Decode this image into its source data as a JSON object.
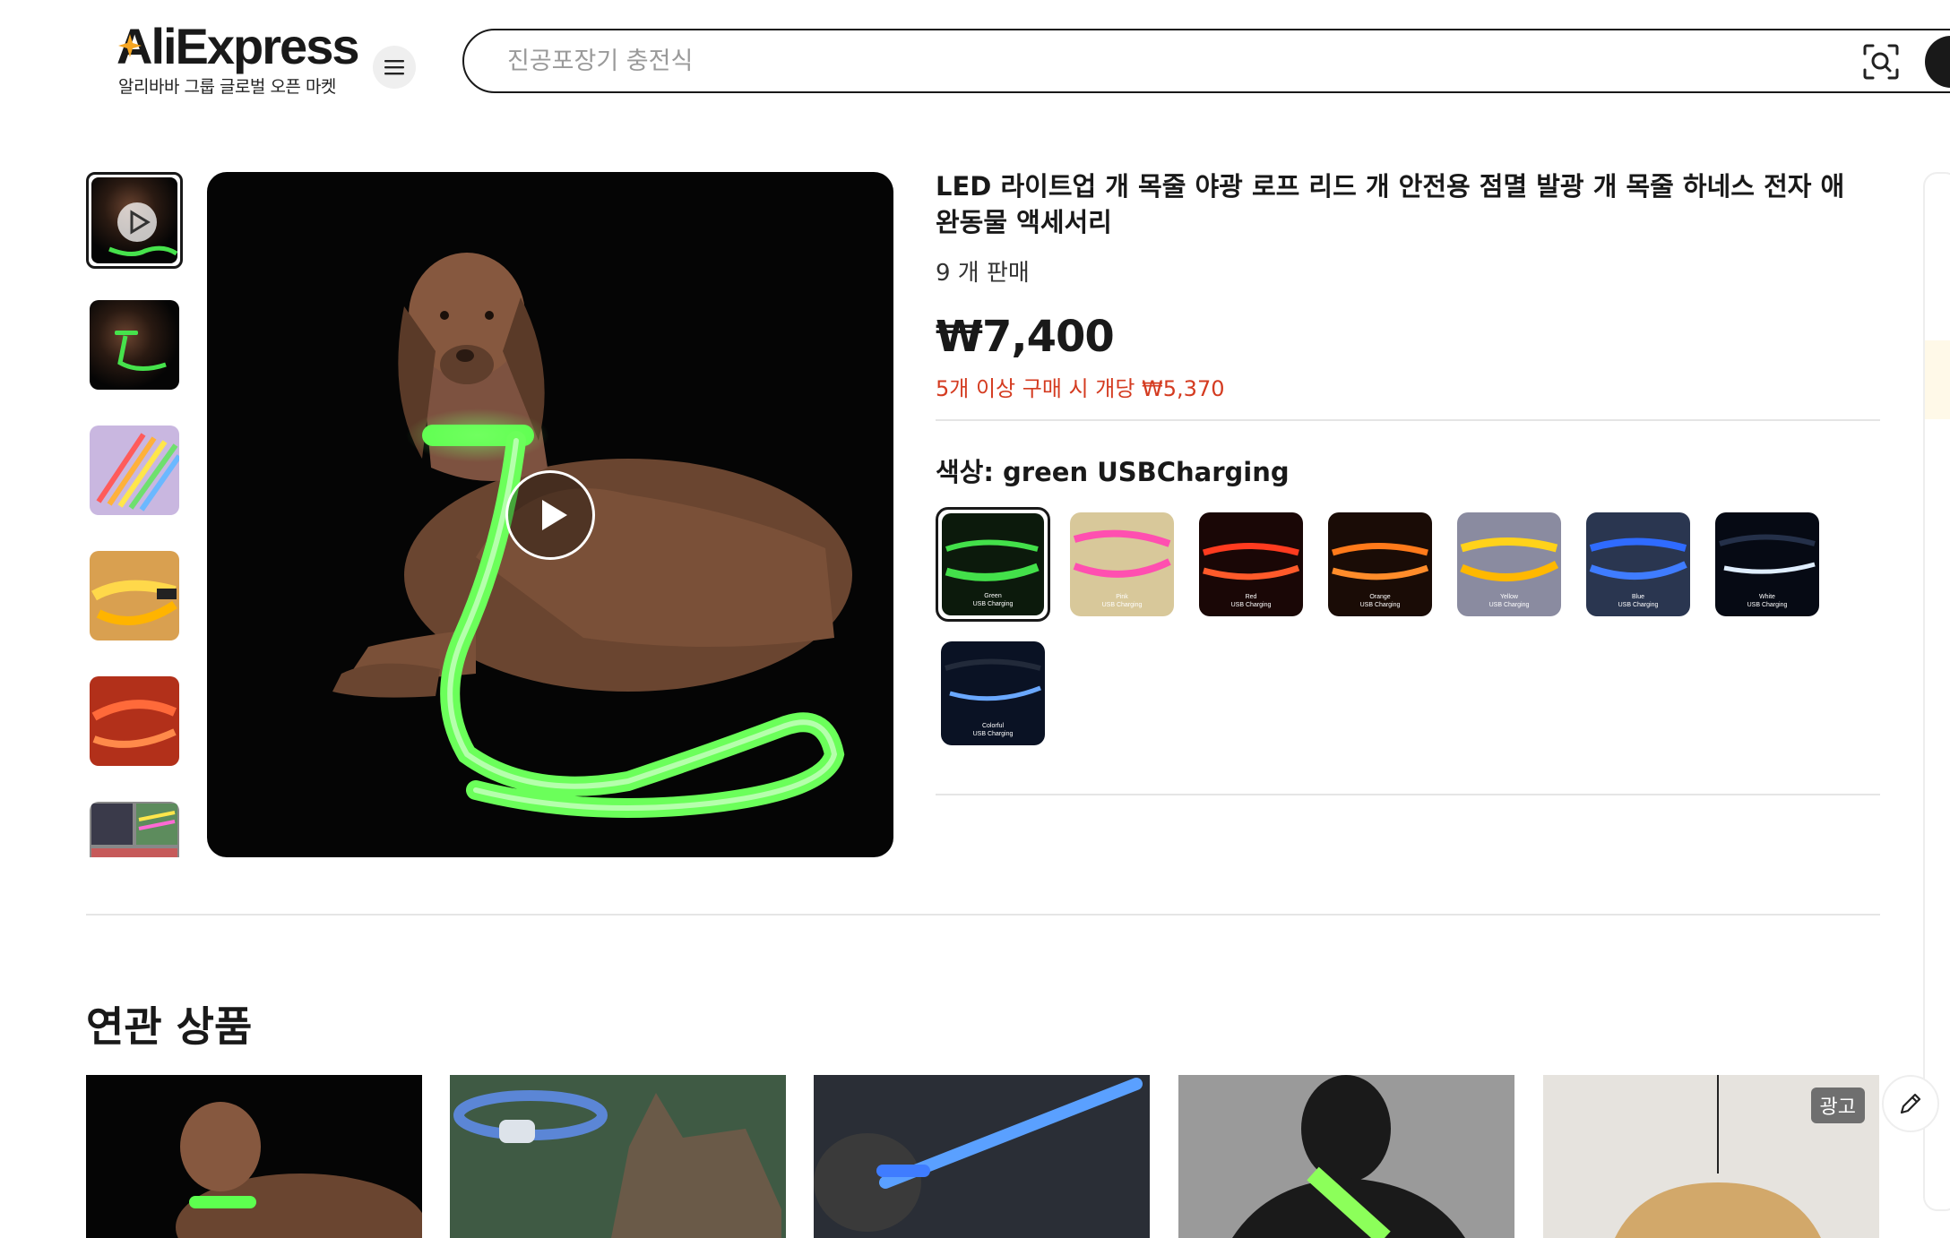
{
  "header": {
    "logo_text": "AliExpress",
    "logo_subtitle": "알리바바 그룹 글로벌 오픈 마켓",
    "search_placeholder": "진공포장기 충전식",
    "menu_icon": "hamburger-icon",
    "camera_icon": "camera-search-icon"
  },
  "product": {
    "title": "LED 라이트업 개 목줄 야광 로프 리드 개 안전용 점멸 발광 개 목줄 하네스 전자 애완동물 액세서리",
    "sold": "9 개 판매",
    "price": "₩7,400",
    "bulk_price": "5개 이상 구매 시 개당 ₩5,370",
    "color_label": "색상: green USBCharging",
    "swatches": [
      {
        "name": "Green",
        "sub": "USB Charging",
        "color": "#43e04a"
      },
      {
        "name": "Pink",
        "sub": "USB Charging",
        "color": "#ff4fb0"
      },
      {
        "name": "Red",
        "sub": "USB Charging",
        "color": "#ff3b1f"
      },
      {
        "name": "Orange",
        "sub": "USB Charging",
        "color": "#ff7a1a"
      },
      {
        "name": "Yellow",
        "sub": "USB Charging",
        "color": "#ffd21a"
      },
      {
        "name": "Blue",
        "sub": "USB Charging",
        "color": "#2f6bff"
      },
      {
        "name": "White",
        "sub": "USB Charging",
        "color": "#dfeeff"
      },
      {
        "name": "Colorful",
        "sub": "USB Charging",
        "color": "#6aa8ff"
      }
    ]
  },
  "gallery": {
    "thumbnails": [
      "video-thumb",
      "dog-green",
      "rainbow",
      "yellow",
      "red",
      "collage"
    ]
  },
  "related": {
    "title": "연관 상품",
    "ad_badge": "광고"
  },
  "colors": {
    "accent_price": "#d43b20",
    "text": "#191919"
  }
}
